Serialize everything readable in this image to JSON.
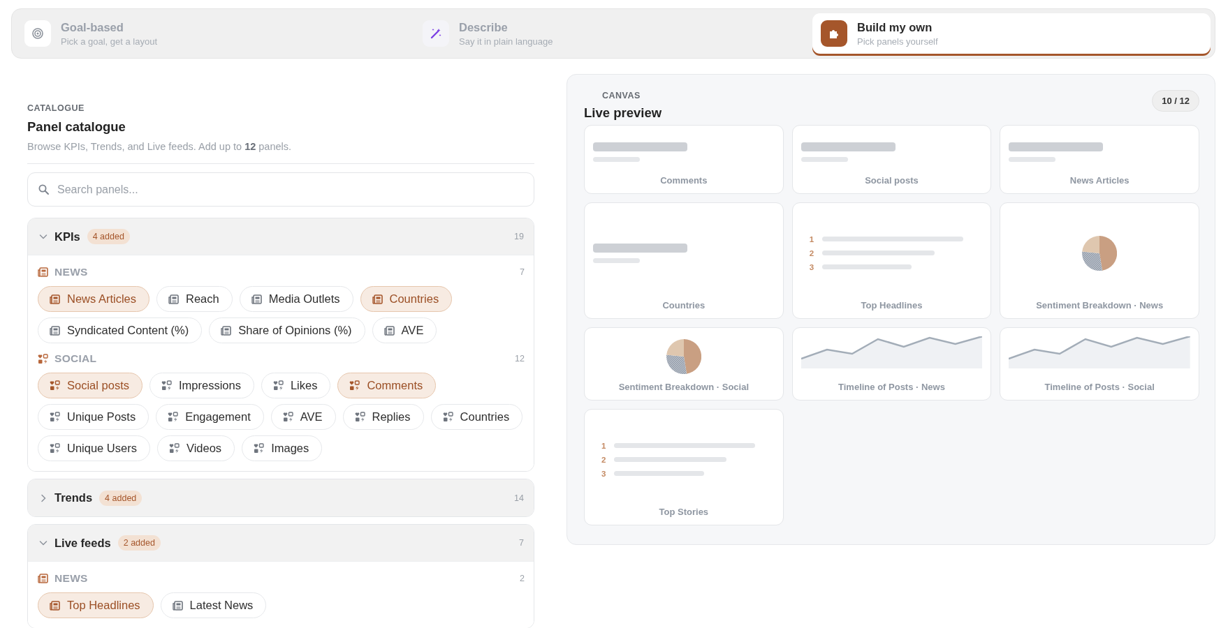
{
  "modes": [
    {
      "kind": "target",
      "title": "Goal-based",
      "subtitle": "Pick a goal, get a layout",
      "selected": false
    },
    {
      "kind": "wand",
      "title": "Describe",
      "subtitle": "Say it in plain language",
      "selected": false
    },
    {
      "kind": "puzzle",
      "title": "Build my own",
      "subtitle": "Pick panels yourself",
      "selected": true
    }
  ],
  "catalogue": {
    "eyebrow": "CATALOGUE",
    "title": "Panel catalogue",
    "description": "Browse KPIs, Trends, and Live feeds. Add up to **12** panels.",
    "search": {
      "placeholder": "Search panels..."
    },
    "groups": [
      {
        "name": "KPIs",
        "badge": "4 added",
        "count": "19",
        "expanded": true,
        "sections": [
          {
            "kind": "news",
            "name": "NEWS",
            "count": "7",
            "chips": [
              {
                "label": "News Articles",
                "selected": true
              },
              {
                "label": "Reach",
                "selected": false
              },
              {
                "label": "Media Outlets",
                "selected": false
              },
              {
                "label": "Countries",
                "selected": true
              },
              {
                "label": "Syndicated Content (%)",
                "selected": false
              },
              {
                "label": "Share of Opinions (%)",
                "selected": false
              },
              {
                "label": "AVE",
                "selected": false
              }
            ]
          },
          {
            "kind": "social",
            "name": "SOCIAL",
            "count": "12",
            "chips": [
              {
                "label": "Social posts",
                "selected": true
              },
              {
                "label": "Impressions",
                "selected": false
              },
              {
                "label": "Likes",
                "selected": false
              },
              {
                "label": "Comments",
                "selected": true
              },
              {
                "label": "Unique Posts",
                "selected": false
              },
              {
                "label": "Engagement",
                "selected": false
              },
              {
                "label": "AVE",
                "selected": false
              },
              {
                "label": "Replies",
                "selected": false
              },
              {
                "label": "Countries",
                "selected": false
              },
              {
                "label": "Unique Users",
                "selected": false
              },
              {
                "label": "Videos",
                "selected": false
              },
              {
                "label": "Images",
                "selected": false
              }
            ]
          }
        ]
      },
      {
        "name": "Trends",
        "badge": "4 added",
        "count": "14",
        "expanded": false
      },
      {
        "name": "Live feeds",
        "badge": "2 added",
        "count": "7",
        "expanded": true,
        "sections": [
          {
            "kind": "news",
            "name": "NEWS",
            "count": "2",
            "chips": [
              {
                "label": "Top Headlines",
                "selected": true
              },
              {
                "label": "Latest News",
                "selected": false
              }
            ]
          }
        ]
      }
    ]
  },
  "canvas": {
    "eyebrow": "CANVAS",
    "title": "Live preview",
    "counter": "10 / 12",
    "panels": [
      {
        "kind": "kpi",
        "label": "Comments"
      },
      {
        "kind": "kpi",
        "label": "Social posts"
      },
      {
        "kind": "kpi",
        "label": "News Articles"
      },
      {
        "kind": "kpi",
        "label": "Countries"
      },
      {
        "kind": "list",
        "label": "Top Headlines",
        "numbers": [
          "1",
          "2",
          "3"
        ]
      },
      {
        "kind": "pie",
        "label": "Sentiment Breakdown · News"
      },
      {
        "kind": "pie",
        "label": "Sentiment Breakdown · Social"
      },
      {
        "kind": "line",
        "label": "Timeline of Posts · News"
      },
      {
        "kind": "line",
        "label": "Timeline of Posts · Social"
      },
      {
        "kind": "list",
        "label": "Top Stories",
        "numbers": [
          "1",
          "2",
          "3"
        ]
      }
    ]
  }
}
